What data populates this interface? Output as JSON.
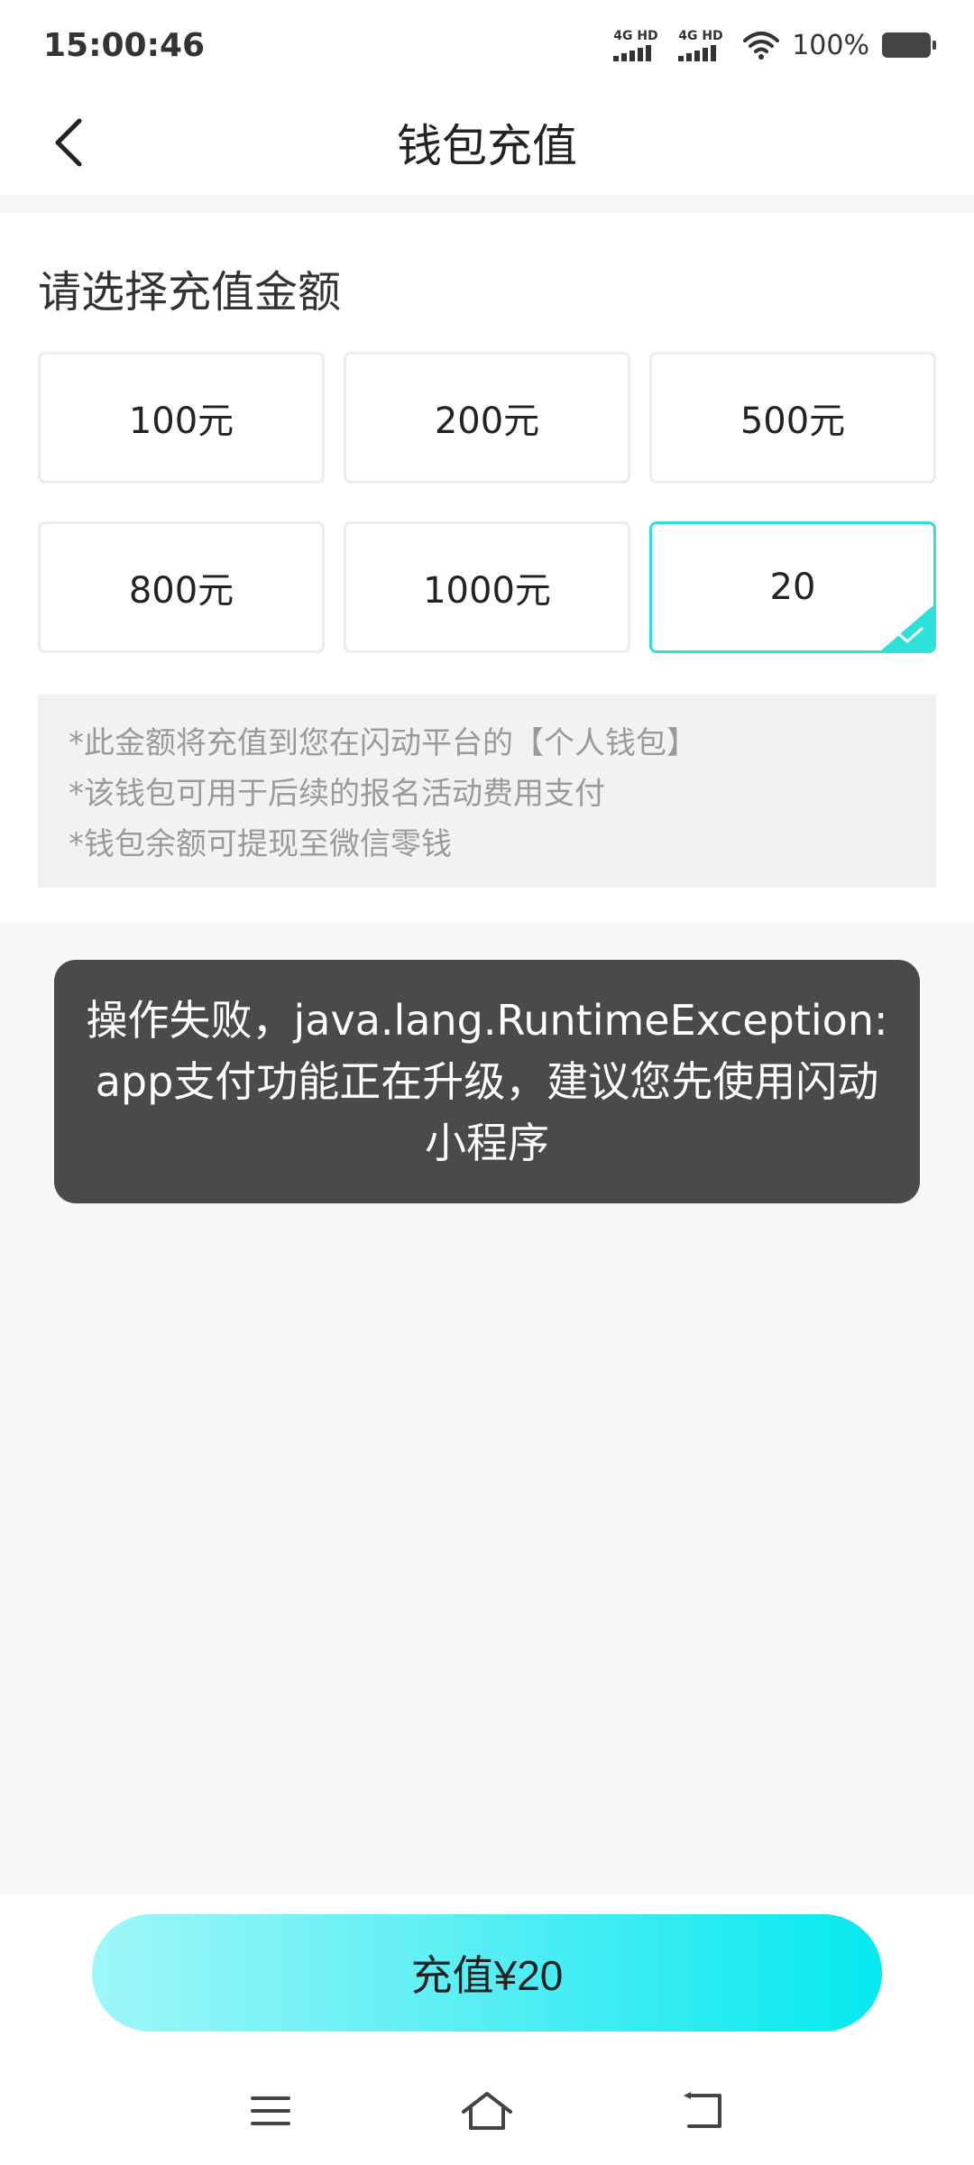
{
  "status_bar": {
    "time": "15:00:46",
    "network1": "4G HD",
    "network2": "4G HD",
    "battery": "100%"
  },
  "header": {
    "title": "钱包充值",
    "back_icon": "chevron-left-icon"
  },
  "recharge": {
    "section_label": "请选择充值金额",
    "options": [
      {
        "label": "100元",
        "selected": false
      },
      {
        "label": "200元",
        "selected": false
      },
      {
        "label": "500元",
        "selected": false
      },
      {
        "label": "800元",
        "selected": false
      },
      {
        "label": "1000元",
        "selected": false
      },
      {
        "label": "20",
        "selected": true
      }
    ],
    "notes": [
      "*此金额将充值到您在闪动平台的【个人钱包】",
      "*该钱包可用于后续的报名活动费用支付",
      "*钱包余额可提现至微信零钱"
    ]
  },
  "toast": {
    "message": "操作失败，java.lang.RuntimeException: app支付功能正在升级，建议您先使用闪动小程序"
  },
  "footer": {
    "recharge_button": "充值¥20"
  },
  "colors": {
    "accent": "#2ee0da",
    "button_gradient_start": "#9ef7f9",
    "button_gradient_end": "#05e9f0",
    "toast_bg": "#4a4a4a"
  },
  "system_nav": {
    "icons": [
      "menu-icon",
      "home-icon",
      "back-icon"
    ]
  }
}
